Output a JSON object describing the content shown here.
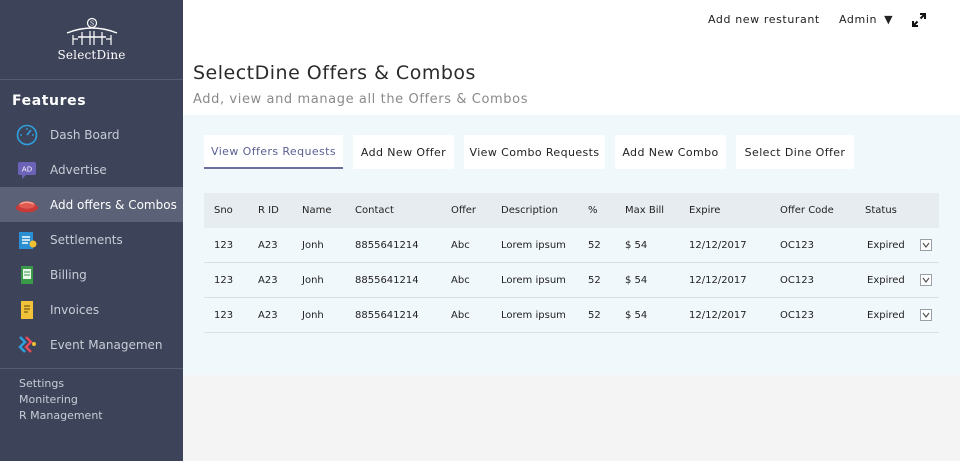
{
  "brand": {
    "logo_text": "SelectDine"
  },
  "sidebar": {
    "section_title": "Features",
    "items": [
      {
        "label": "Dash Board",
        "icon": "dashboard-icon"
      },
      {
        "label": "Advertise",
        "icon": "ad-icon"
      },
      {
        "label": "Add offers & Combos",
        "icon": "offers-icon"
      },
      {
        "label": "Settlements",
        "icon": "settlements-icon"
      },
      {
        "label": "Billing",
        "icon": "billing-icon"
      },
      {
        "label": "Invoices",
        "icon": "invoices-icon"
      },
      {
        "label": "Event Managemen",
        "icon": "event-icon"
      }
    ],
    "bottom_links": [
      "Settings",
      "Monitering",
      "R Management"
    ]
  },
  "topbar": {
    "add_restaurant": "Add new resturant",
    "admin": "Admin",
    "admin_caret": "▼"
  },
  "header": {
    "title": "SelectDine Offers & Combos",
    "subtitle": "Add, view and manage all the Offers & Combos"
  },
  "tabs": [
    {
      "label": "View Offers Requests",
      "active": true
    },
    {
      "label": "Add New Offer"
    },
    {
      "label": "View Combo Requests"
    },
    {
      "label": "Add New Combo"
    },
    {
      "label": "Select Dine Offer"
    }
  ],
  "table": {
    "columns": [
      "Sno",
      "R ID",
      "Name",
      "Contact",
      "Offer",
      "Description",
      "%",
      "Max Bill",
      "Expire",
      "Offer Code",
      "Status"
    ],
    "rows": [
      [
        "123",
        "A23",
        "Jonh",
        "8855641214",
        "Abc",
        "Lorem ipsum",
        "52",
        "$ 54",
        "12/12/2017",
        "OC123",
        "Expired"
      ],
      [
        "123",
        "A23",
        "Jonh",
        "8855641214",
        "Abc",
        "Lorem ipsum",
        "52",
        "$ 54",
        "12/12/2017",
        "OC123",
        "Expired"
      ],
      [
        "123",
        "A23",
        "Jonh",
        "8855641214",
        "Abc",
        "Lorem ipsum",
        "52",
        "$ 54",
        "12/12/2017",
        "OC123",
        "Expired"
      ]
    ]
  },
  "colors": {
    "sidebar_bg": "#3d4358",
    "sidebar_active": "#5b6176",
    "content_bg": "#f1f8fc",
    "tab_active": "#5a5f93"
  }
}
